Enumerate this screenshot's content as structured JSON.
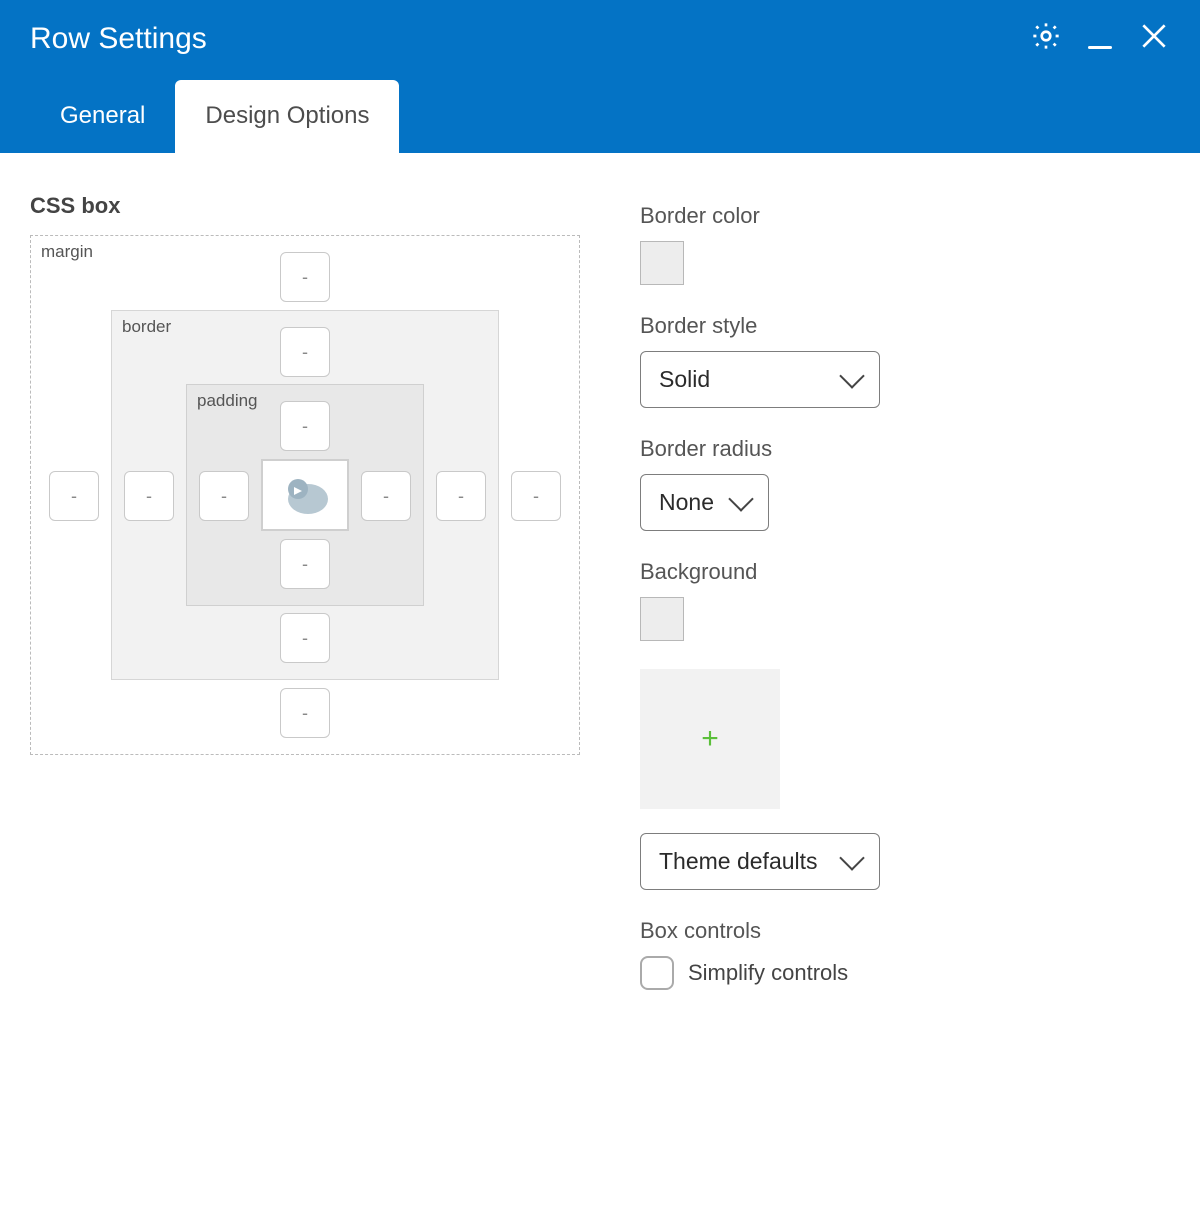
{
  "header": {
    "title": "Row Settings"
  },
  "tabs": {
    "general": "General",
    "design": "Design Options"
  },
  "left": {
    "section": "CSS box",
    "labels": {
      "margin": "margin",
      "border": "border",
      "padding": "padding"
    },
    "placeholder": "-"
  },
  "right": {
    "border_color_label": "Border color",
    "border_style_label": "Border style",
    "border_style_value": "Solid",
    "border_radius_label": "Border radius",
    "border_radius_value": "None",
    "background_label": "Background",
    "bg_select_value": "Theme defaults",
    "box_controls_label": "Box controls",
    "simplify_label": "Simplify controls"
  }
}
